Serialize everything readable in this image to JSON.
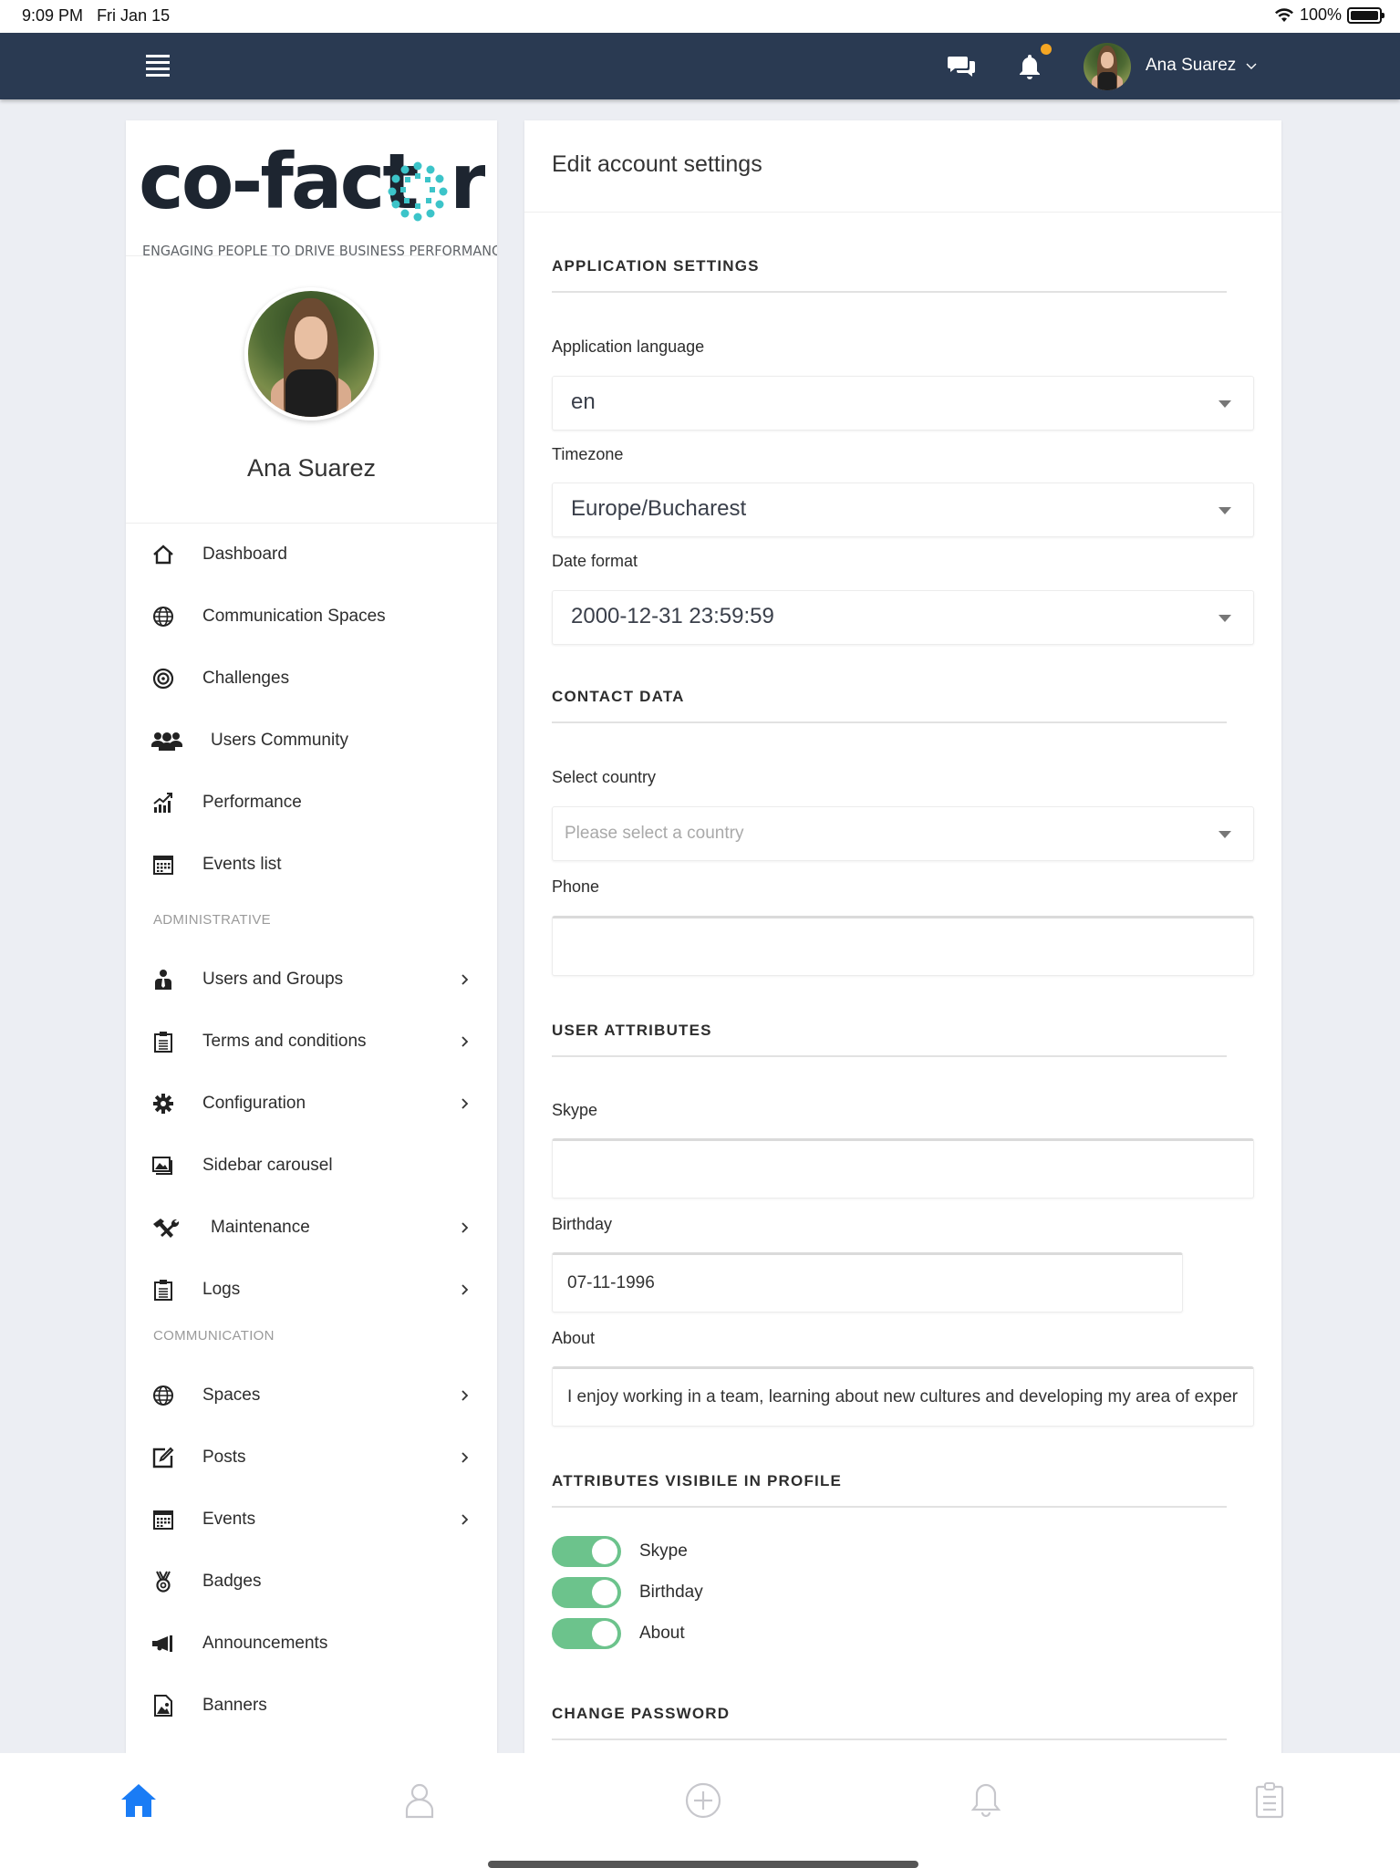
{
  "status_bar": {
    "time": "9:09 PM",
    "date": "Fri Jan 15",
    "battery": "100%"
  },
  "top_nav": {
    "user_name": "Ana Suarez",
    "has_notification": true,
    "notification_color": "#f5a623",
    "bg_color": "#2a3a52"
  },
  "sidebar": {
    "logo": {
      "word": "co-factor",
      "tagline": "ENGAGING PEOPLE TO DRIVE BUSINESS PERFORMANCE",
      "accent_color": "#3cc4c9"
    },
    "profile_name": "Ana Suarez",
    "items": [
      {
        "label": "Dashboard",
        "icon": "home-icon",
        "chevron": false
      },
      {
        "label": "Communication Spaces",
        "icon": "globe-icon",
        "chevron": false
      },
      {
        "label": "Challenges",
        "icon": "target-icon",
        "chevron": false
      },
      {
        "label": "Users Community",
        "icon": "users-icon",
        "chevron": false
      },
      {
        "label": "Performance",
        "icon": "chart-icon",
        "chevron": false
      },
      {
        "label": "Events list",
        "icon": "calendar-icon",
        "chevron": false
      }
    ],
    "section_admin": "ADMINISTRATIVE",
    "admin_items": [
      {
        "label": "Users and Groups",
        "icon": "user-tie-icon",
        "chevron": true
      },
      {
        "label": "Terms and conditions",
        "icon": "clipboard-icon",
        "chevron": true
      },
      {
        "label": "Configuration",
        "icon": "gear-icon",
        "chevron": true
      },
      {
        "label": "Sidebar carousel",
        "icon": "images-icon",
        "chevron": false
      },
      {
        "label": "Maintenance",
        "icon": "tools-icon",
        "chevron": true
      },
      {
        "label": "Logs",
        "icon": "clipboard-icon",
        "chevron": true
      }
    ],
    "section_communication": "COMMUNICATION",
    "communication_items": [
      {
        "label": "Spaces",
        "icon": "globe-icon",
        "chevron": true
      },
      {
        "label": "Posts",
        "icon": "edit-icon",
        "chevron": true
      },
      {
        "label": "Events",
        "icon": "calendar-icon",
        "chevron": true
      },
      {
        "label": "Badges",
        "icon": "medal-icon",
        "chevron": false
      },
      {
        "label": "Announcements",
        "icon": "megaphone-icon",
        "chevron": false
      },
      {
        "label": "Banners",
        "icon": "image-file-icon",
        "chevron": false
      }
    ]
  },
  "main": {
    "title": "Edit account settings",
    "application_settings": {
      "heading": "APPLICATION SETTINGS",
      "language_label": "Application language",
      "language_value": "en",
      "timezone_label": "Timezone",
      "timezone_value": "Europe/Bucharest",
      "date_format_label": "Date format",
      "date_format_value": "2000-12-31 23:59:59"
    },
    "contact_data": {
      "heading": "CONTACT DATA",
      "country_label": "Select country",
      "country_placeholder": "Please select a country",
      "phone_label": "Phone",
      "phone_value": ""
    },
    "user_attributes": {
      "heading": "USER ATTRIBUTES",
      "skype_label": "Skype",
      "skype_value": "",
      "birthday_label": "Birthday",
      "birthday_value": "07-11-1996",
      "about_label": "About",
      "about_value": "I enjoy working in a team, learning about new cultures and developing my area of exper"
    },
    "visibility": {
      "heading": "ATTRIBUTES VISIBILE IN PROFILE",
      "toggles": [
        {
          "label": "Skype",
          "on": true
        },
        {
          "label": "Birthday",
          "on": true
        },
        {
          "label": "About",
          "on": true
        }
      ],
      "toggle_color": "#6cc38c"
    },
    "change_password": {
      "heading": "CHANGE PASSWORD"
    }
  },
  "tab_bar": {
    "active_color": "#1a7cf5",
    "inactive_color": "#c7c7cc",
    "tabs": [
      {
        "name": "home",
        "active": true
      },
      {
        "name": "profile",
        "active": false
      },
      {
        "name": "add",
        "active": false
      },
      {
        "name": "notifications",
        "active": false
      },
      {
        "name": "tasks",
        "active": false
      }
    ]
  }
}
